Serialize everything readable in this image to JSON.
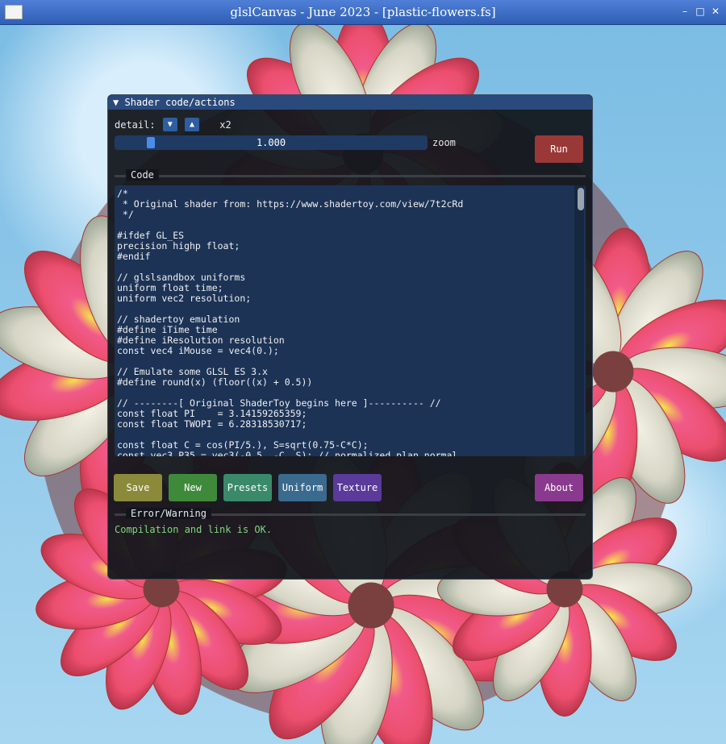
{
  "window": {
    "title": "glslCanvas - June 2023 - [plastic-flowers.fs]"
  },
  "panel": {
    "header": "Shader code/actions",
    "detail_label": "detail:",
    "detail_multiplier": "x2",
    "zoom_value": "1.000",
    "zoom_label": "zoom",
    "run_label": "Run",
    "code_section_label": "Code",
    "error_section_label": "Error/Warning",
    "status_text": "Compilation and link is OK.",
    "buttons": [
      {
        "label": "Save",
        "color": "#8b8a3a"
      },
      {
        "label": "New",
        "color": "#3f8a3a"
      },
      {
        "label": "Presets",
        "color": "#3a8a6a"
      },
      {
        "label": "Uniform",
        "color": "#3a6a8e"
      },
      {
        "label": "Texture",
        "color": "#5a3a9a"
      },
      {
        "label": "About",
        "color": "#8a3a8e"
      }
    ],
    "run_color": "#9a3838"
  },
  "code": "/*\n * Original shader from: https://www.shadertoy.com/view/7t2cRd\n */\n\n#ifdef GL_ES\nprecision highp float;\n#endif\n\n// glslsandbox uniforms\nuniform float time;\nuniform vec2 resolution;\n\n// shadertoy emulation\n#define iTime time\n#define iResolution resolution\nconst vec4 iMouse = vec4(0.);\n\n// Emulate some GLSL ES 3.x\n#define round(x) (floor((x) + 0.5))\n\n// --------[ Original ShaderToy begins here ]---------- //\nconst float PI    = 3.14159265359;\nconst float TWOPI = 6.28318530717;\n\nconst float C = cos(PI/5.), S=sqrt(0.75-C*C);\nconst vec3 P35 = vec3(-0.5, -C, S); // normalized plan normal"
}
